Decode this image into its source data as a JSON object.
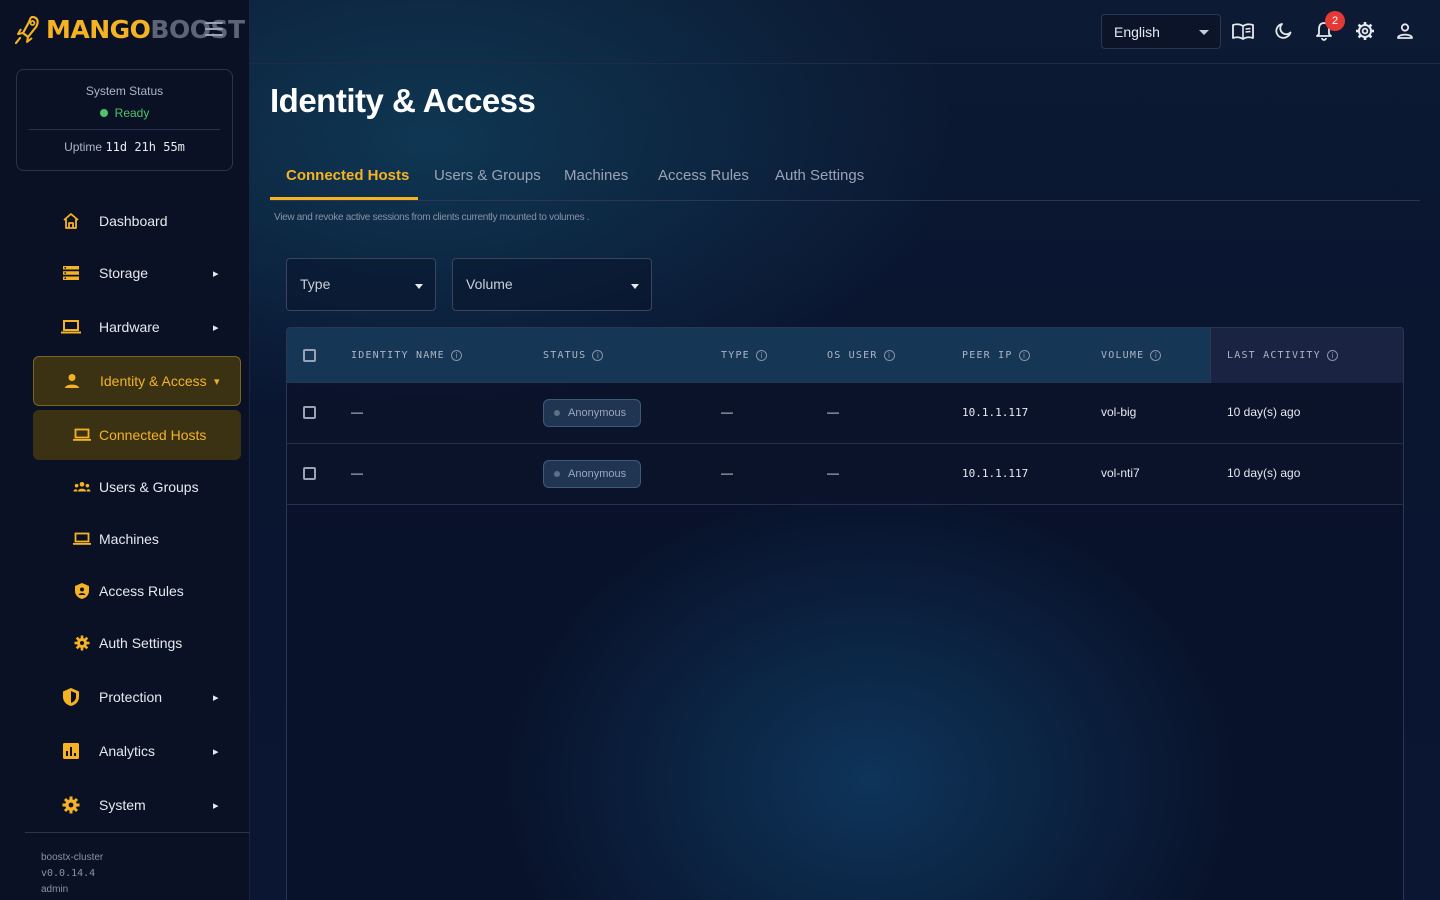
{
  "brand": {
    "part1": "MANGO",
    "part2": "BOOST"
  },
  "colors": {
    "accent": "#f5b324",
    "ready": "#4cc26a",
    "badge": "#e53935"
  },
  "system_status": {
    "title": "System Status",
    "state": "Ready",
    "uptime_label": "Uptime",
    "uptime_value": "11d 21h 55m"
  },
  "nav": {
    "dashboard": "Dashboard",
    "storage": "Storage",
    "hardware": "Hardware",
    "identity": "Identity & Access",
    "sub": {
      "connected_hosts": "Connected Hosts",
      "users_groups": "Users & Groups",
      "machines": "Machines",
      "access_rules": "Access Rules",
      "auth_settings": "Auth Settings"
    },
    "protection": "Protection",
    "analytics": "Analytics",
    "system": "System"
  },
  "footer": {
    "cluster": "boostx-cluster",
    "version": "v0.0.14.4",
    "user": "admin"
  },
  "topbar": {
    "language": "English",
    "notification_count": "2",
    "icons": [
      "book-icon",
      "moon-icon",
      "bell-icon",
      "gear-icon",
      "user-icon"
    ]
  },
  "page": {
    "title": "Identity & Access",
    "tabs": [
      "Connected Hosts",
      "Users & Groups",
      "Machines",
      "Access Rules",
      "Auth Settings"
    ],
    "active_tab": "Connected Hosts",
    "subtitle": "View and revoke active sessions from clients currently mounted to volumes ."
  },
  "filters": {
    "type": "Type",
    "volume": "Volume"
  },
  "table": {
    "columns": [
      "IDENTITY NAME",
      "STATUS",
      "TYPE",
      "OS USER",
      "PEER IP",
      "VOLUME",
      "LAST ACTIVITY"
    ],
    "rows": [
      {
        "identity": "—",
        "status": "Anonymous",
        "type": "—",
        "os_user": "—",
        "peer_ip": "10.1.1.117",
        "volume": "vol-big",
        "last_activity": "10 day(s) ago"
      },
      {
        "identity": "—",
        "status": "Anonymous",
        "type": "—",
        "os_user": "—",
        "peer_ip": "10.1.1.117",
        "volume": "vol-nti7",
        "last_activity": "10 day(s) ago"
      }
    ]
  }
}
